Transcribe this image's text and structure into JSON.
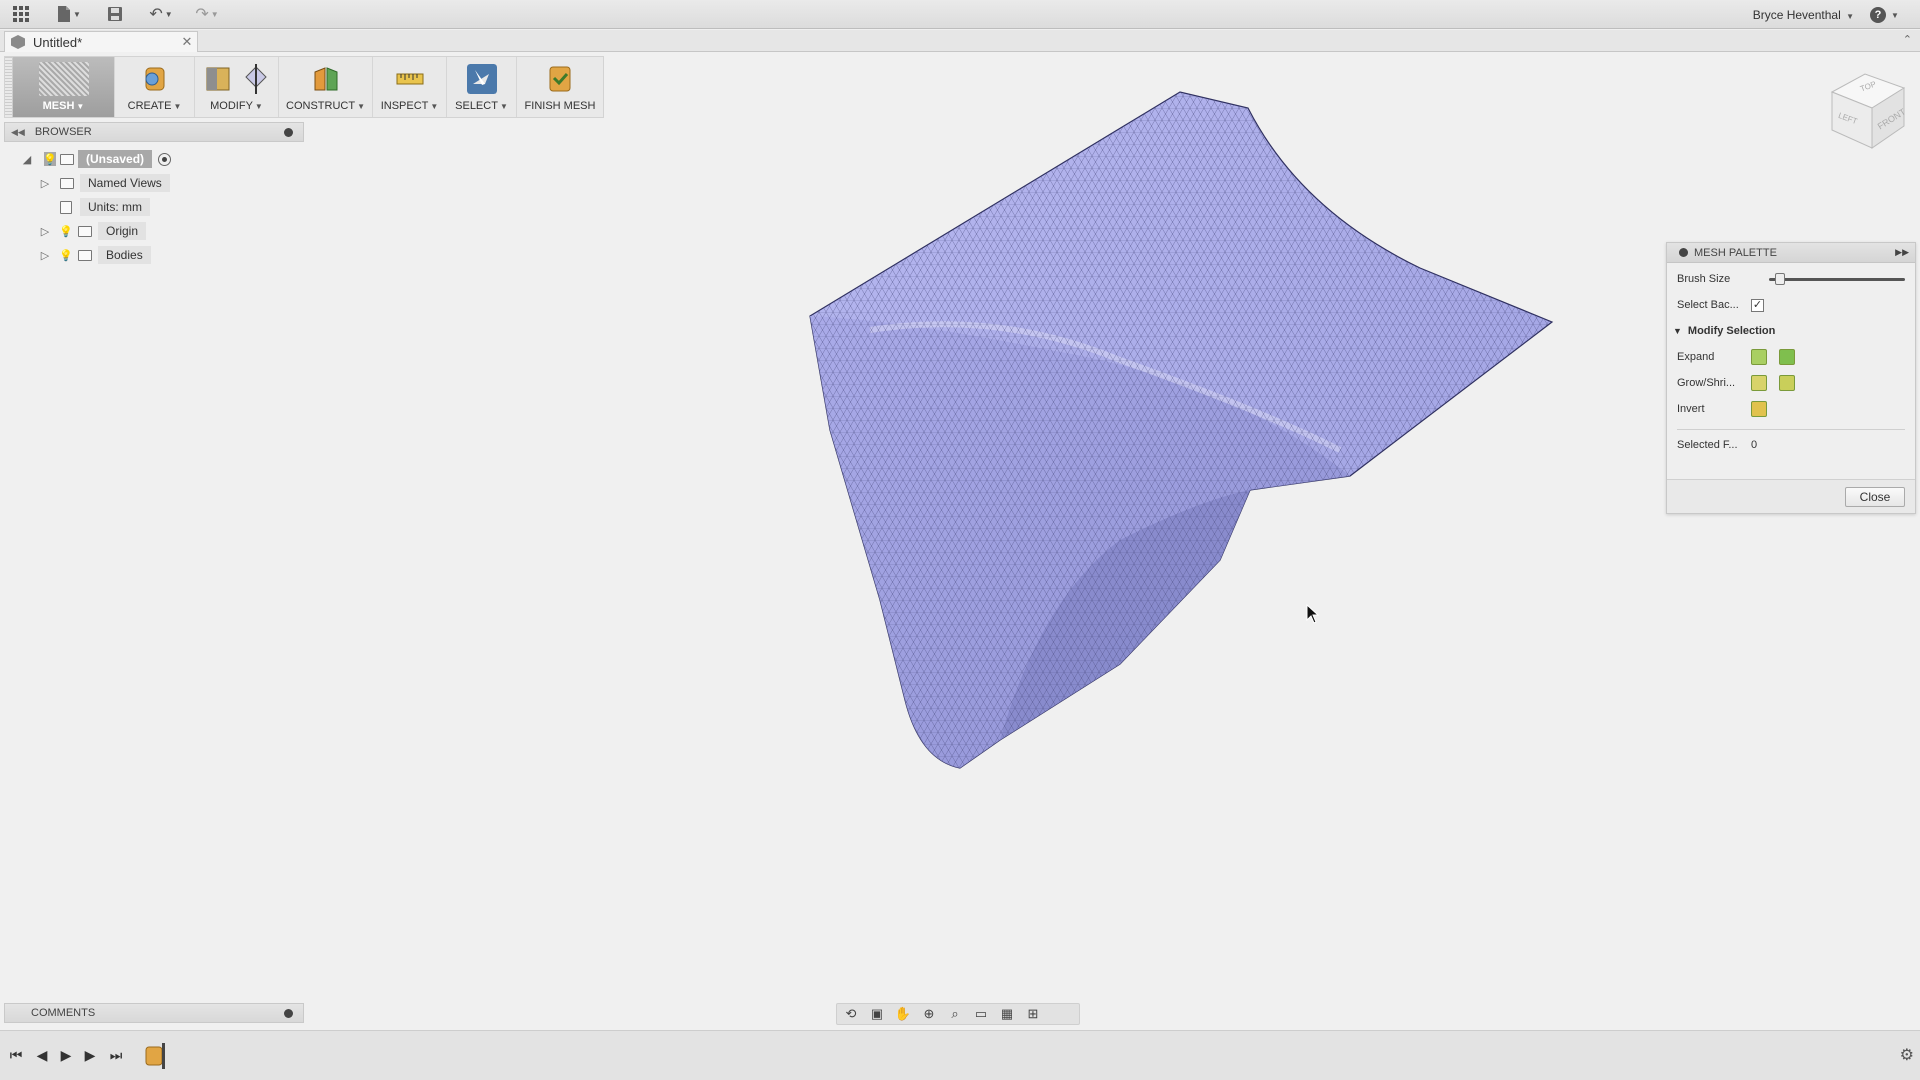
{
  "app": {
    "user_name": "Bryce Heventhal",
    "help_label": "?"
  },
  "tab": {
    "title": "Untitled*",
    "close": "✕"
  },
  "toolbar": {
    "mesh": "MESH",
    "create": "CREATE",
    "modify": "MODIFY",
    "construct": "CONSTRUCT",
    "inspect": "INSPECT",
    "select": "SELECT",
    "finish_mesh": "FINISH MESH"
  },
  "browser": {
    "header": "BROWSER",
    "root": "(Unsaved)",
    "items": [
      {
        "label": "Named Views"
      },
      {
        "label": "Units: mm"
      },
      {
        "label": "Origin"
      },
      {
        "label": "Bodies"
      }
    ]
  },
  "viewcube": {
    "top": "TOP",
    "front": "FRONT",
    "left": "LEFT"
  },
  "mesh_palette": {
    "title": "MESH PALETTE",
    "brush_size_label": "Brush Size",
    "brush_size_fraction": 0.05,
    "select_back_label": "Select Bac...",
    "select_back_checked": true,
    "section": "Modify Selection",
    "expand_label": "Expand",
    "grow_shrink_label": "Grow/Shri...",
    "invert_label": "Invert",
    "selected_faces_label": "Selected F...",
    "selected_faces_value": "0",
    "close_label": "Close"
  },
  "comments": {
    "header": "COMMENTS"
  },
  "colors": {
    "mesh_fill": "#a7a8e6",
    "mesh_edge": "#3d3e6a",
    "panel_bg": "#efefef",
    "viewport_bg": "#f0f0f0"
  }
}
